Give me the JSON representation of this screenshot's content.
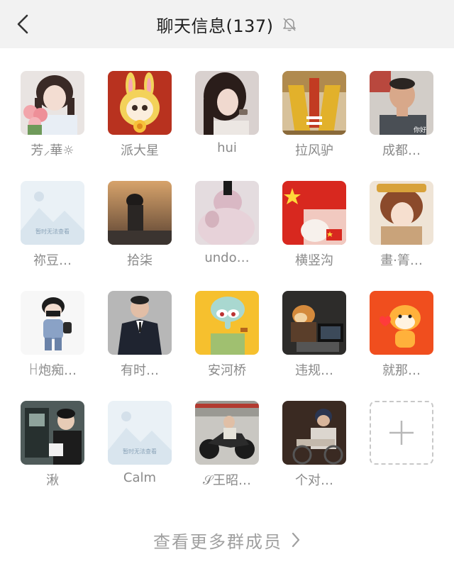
{
  "header": {
    "title": "聊天信息(137)",
    "back_icon": "chevron-left-icon",
    "mute_icon": "bell-off-icon"
  },
  "members": [
    {
      "name": "芳⸝華☼",
      "avatar": "girl-with-roses"
    },
    {
      "name": "派大星",
      "avatar": "cartoon-rabbit"
    },
    {
      "name": "hui",
      "avatar": "girl-portrait"
    },
    {
      "name": "拉风驴",
      "avatar": "crane-machine"
    },
    {
      "name": "成都…",
      "avatar": "man-selfie"
    },
    {
      "name": "祢豆…",
      "avatar": "image-unavailable",
      "placeholder_text": "暂时无法查看"
    },
    {
      "name": "拾柒",
      "avatar": "sunset-silhouette"
    },
    {
      "name": "undo…",
      "avatar": "pink-hoodie"
    },
    {
      "name": "横竖沟",
      "avatar": "flag-cat"
    },
    {
      "name": "畫·箐…",
      "avatar": "anime-boy"
    },
    {
      "name": "ꀿ炮痴…",
      "avatar": "cartoon-boy-mask"
    },
    {
      "name": "有时…",
      "avatar": "man-in-suit"
    },
    {
      "name": "安河桥",
      "avatar": "squidward"
    },
    {
      "name": "违规…",
      "avatar": "dog-at-computer"
    },
    {
      "name": "就那…",
      "avatar": "cartoon-tiger"
    },
    {
      "name": "湫",
      "avatar": "boy-phone-booth"
    },
    {
      "name": "Calm",
      "avatar": "image-unavailable",
      "placeholder_text": "暂时无法查看"
    },
    {
      "name": "𝒮王昭…",
      "avatar": "motorcycle-rider"
    },
    {
      "name": "个对…",
      "avatar": "man-on-bike"
    }
  ],
  "add_member": {
    "icon": "plus-icon"
  },
  "more_link": {
    "label": "查看更多群成员",
    "icon": "chevron-right-icon"
  },
  "colors": {
    "header_bg": "#f2f2f2",
    "name_gray": "#8a8a8a",
    "link_gray": "#a0a0a0"
  }
}
